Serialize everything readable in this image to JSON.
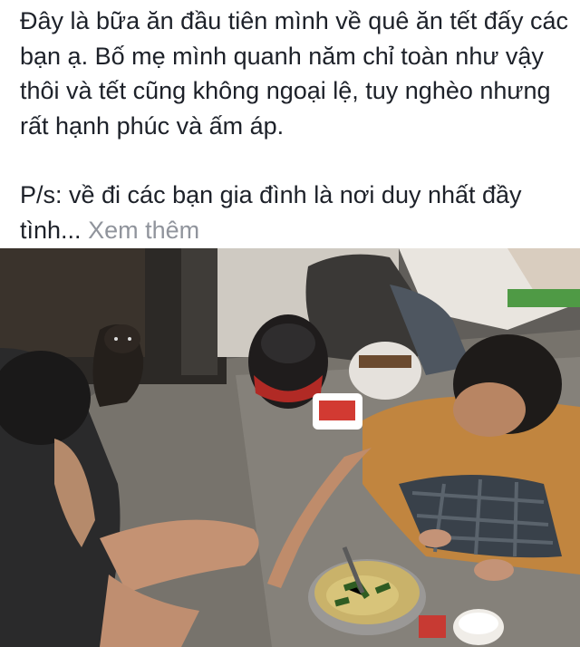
{
  "post": {
    "paragraph1": "Đây là bữa ăn đầu tiên mình về quê ăn tết đấy các bạn ạ. Bố mẹ mình quanh năm chỉ toàn như vậy thôi và tết cũng không ngoại lệ, tuy nghèo nhưng rất hạnh phúc và ấm áp.",
    "paragraph2": "P/s: về đi các bạn gia đình là nơi duy nhất đầy tình...",
    "see_more_label": "Xem thêm"
  },
  "photo": {
    "description_icon": "photo-image"
  }
}
